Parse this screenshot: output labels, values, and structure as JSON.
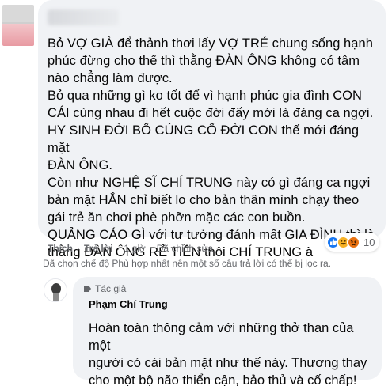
{
  "main_comment": {
    "paragraphs": [
      "Bỏ VỢ GIÀ để thảnh thơi lấy VỢ TRẺ chung sống hạnh\nphúc đừng cho thế thì thằng ĐÀN ÔNG không có tâm\nnào chẳng làm được.",
      "Bỏ qua những gì ko tốt để vì hạnh phúc gia đình CON\nCÁI cùng nhau đi hết cuộc đời đấy mới là đáng ca ngợi.",
      "HY SINH ĐỜI BỐ CỦNG CỐ ĐỜI CON thế mới đáng mặt\nĐÀN ÔNG.",
      "Còn như NGHỆ SĨ CHÍ TRUNG này có gì đáng ca ngợi\nbản mặt HẮN chỉ biết lo cho bản thân mình chạy theo\ngái trẻ ăn chơi phè phỡn mặc các con buồn.",
      "QUẢNG CÁO GÌ với tư tưởng đánh mất GIA ĐÌNH thì là\nthằng ĐÀN ÔNG RẺ TIỀN thôi CHÍ TRUNG à"
    ],
    "reaction_count": "10",
    "reaction_icons": [
      "like-icon",
      "haha-icon",
      "angry-icon"
    ],
    "actions": {
      "like": "Thích",
      "reply": "Trả lời",
      "time": "1 giờ",
      "edited": "Đã chỉnh sửa"
    },
    "filter_note": "Đã chọn chế độ Phù hợp nhất nên một số câu trả lời có thể bị lọc ra."
  },
  "reply": {
    "author_tag": "Tác giả",
    "author_name": "Phạm Chí Trung",
    "text": "Hoàn toàn thông cảm với những thở than của một\nngười có cái bản mặt như thế này. Thương thay\ncho một bộ não thiển cận, bảo thủ và cố chấp!"
  },
  "colors": {
    "bubble": "#f0f2f5",
    "text": "#050505",
    "secondary": "#65676b",
    "like": "#1877f2",
    "haha": "#f7b125",
    "angry": "#e9710f"
  }
}
